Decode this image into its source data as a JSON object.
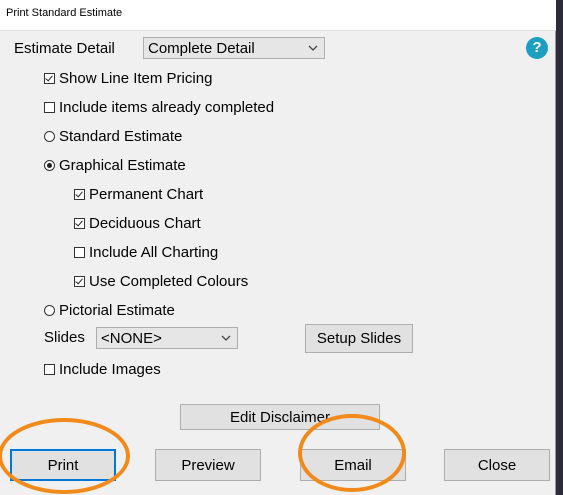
{
  "window": {
    "title": "Print Standard Estimate"
  },
  "estimate_detail": {
    "label": "Estimate Detail",
    "selected": "Complete Detail"
  },
  "help": {
    "glyph": "?"
  },
  "options": {
    "show_line_item_pricing": {
      "label": "Show Line Item Pricing",
      "checked": true
    },
    "include_completed": {
      "label": "Include items already completed",
      "checked": false
    },
    "standard_estimate": {
      "label": "Standard Estimate",
      "selected": false
    },
    "graphical_estimate": {
      "label": "Graphical Estimate",
      "selected": true
    },
    "permanent_chart": {
      "label": "Permanent Chart",
      "checked": true
    },
    "deciduous_chart": {
      "label": "Deciduous Chart",
      "checked": true
    },
    "include_all_charting": {
      "label": "Include All Charting",
      "checked": false
    },
    "use_completed_colours": {
      "label": "Use Completed Colours",
      "checked": true
    },
    "pictorial_estimate": {
      "label": "Pictorial Estimate",
      "selected": false
    },
    "include_images": {
      "label": "Include Images",
      "checked": false
    }
  },
  "slides": {
    "label": "Slides",
    "selected": "<NONE>",
    "setup_button": "Setup Slides"
  },
  "buttons": {
    "edit_disclaimer": "Edit Disclaimer",
    "print": "Print",
    "preview": "Preview",
    "email": "Email",
    "close": "Close"
  },
  "colors": {
    "annotation": "#f28a1b",
    "help": "#1d9fc4"
  }
}
